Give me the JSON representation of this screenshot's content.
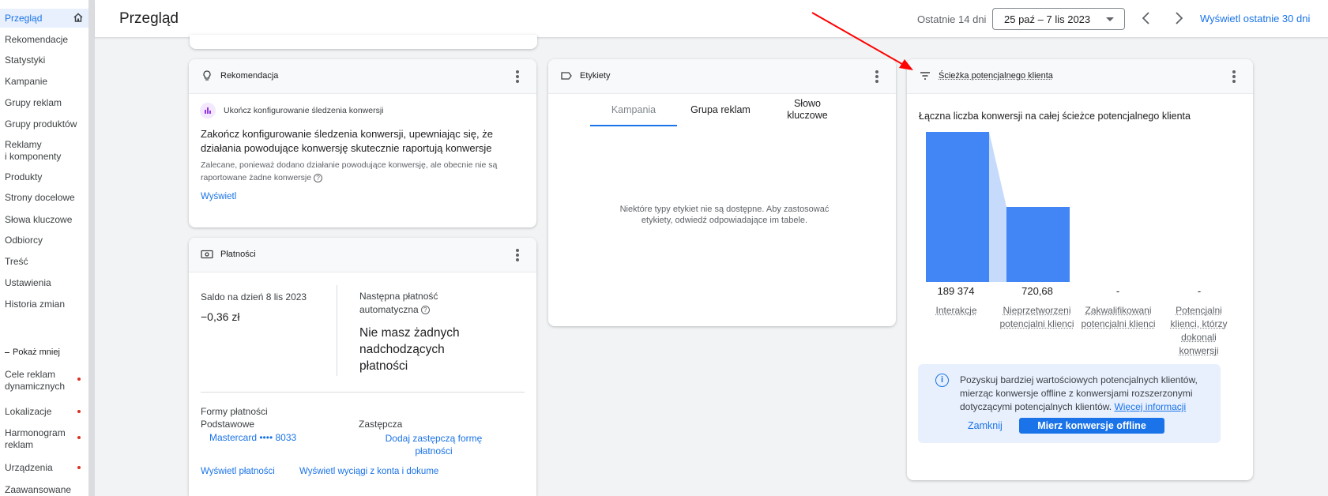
{
  "sidebar": {
    "items": [
      {
        "label": "Przegląd",
        "active": true
      },
      {
        "label": "Rekomendacje"
      },
      {
        "label": "Statystyki"
      },
      {
        "label": "Kampanie"
      },
      {
        "label": "Grupy reklam"
      },
      {
        "label": "Grupy produktów"
      },
      {
        "label": "Reklamy\ni komponenty"
      },
      {
        "label": "Produkty"
      },
      {
        "label": "Strony docelowe"
      },
      {
        "label": "Słowa kluczowe"
      },
      {
        "label": "Odbiorcy"
      },
      {
        "label": "Treść"
      },
      {
        "label": "Ustawienia"
      },
      {
        "label": "Historia zmian"
      }
    ],
    "show_less": "Pokaż mniej",
    "extra_items": [
      {
        "label": "Cele reklam\ndynamicznych",
        "dot": true
      },
      {
        "label": "Lokalizacje",
        "dot": true
      },
      {
        "label": "Harmonogram\nreklam",
        "dot": true
      },
      {
        "label": "Urządzenia",
        "dot": true
      },
      {
        "label": "Zaawansowane"
      }
    ]
  },
  "header": {
    "title": "Przegląd",
    "range_label": "Ostatnie 14 dni",
    "date_range": "25 paź – 7 lis 2023",
    "view_30_days": "Wyświetl ostatnie 30 dni"
  },
  "recommendation": {
    "title": "Rekomendacja",
    "chip_label": "Ukończ konfigurowanie śledzenia konwersji",
    "headline": "Zakończ konfigurowanie śledzenia konwersji, upewniając się, że działania powodujące konwersję skutecznie raportują konwersje",
    "description": "Zalecane, ponieważ dodano działanie powodujące konwersję, ale obecnie nie są raportowane żadne konwersje",
    "link": "Wyświetl"
  },
  "payments": {
    "title": "Płatności",
    "balance_label": "Saldo na dzień 8 lis 2023",
    "balance_value": "−0,36 zł",
    "next_payment_label": "Następna płatność automatyczna",
    "next_payment_value": "Nie masz żadnych nadchodzących płatności",
    "forms_label": "Formy płatności",
    "primary_label": "Podstawowe",
    "alternate_label": "Zastępcza",
    "card": "Mastercard •••• 8033",
    "add_alternate": "Dodaj zastępczą formę płatności",
    "view_payments": "Wyświetl płatności",
    "view_statements": "Wyświetl wyciągi z konta i dokume"
  },
  "labels": {
    "title": "Etykiety",
    "tabs": [
      "Kampania",
      "Grupa reklam",
      "Słowo\nkluczowe"
    ],
    "message": "Niektóre typy etykiet nie są dostępne. Aby zastosować etykiety, odwiedź odpowiadające im tabele."
  },
  "funnel": {
    "title": "Ścieżka potencjalnego klienta",
    "subtitle": "Łączna liczba konwersji na całej ścieżce potencjalnego klienta",
    "info_text": "Pozyskuj bardziej wartościowych potencjalnych klientów, mierząc konwersje offline z konwersjami rozszerzonymi dotyczącymi potencjalnych klientów. ",
    "info_link": "Więcej informacji",
    "close_button": "Zamknij",
    "measure_button": "Mierz konwersje offline"
  },
  "chart_data": {
    "type": "bar",
    "categories": [
      "Interakcje",
      "Nieprzetworzeni potencjalni klienci",
      "Zakwalifikowani potencjalni klienci",
      "Potencjalni klienci, którzy dokonali konwersji"
    ],
    "values": [
      189374,
      720.68,
      null,
      null
    ],
    "value_labels": [
      "189 374",
      "720,68",
      "-",
      "-"
    ],
    "bar_color": "#4285f4",
    "connector_color": "#c6dafc"
  },
  "colors": {
    "accent": "#1a73e8",
    "annotation_arrow": "#ff0000"
  }
}
